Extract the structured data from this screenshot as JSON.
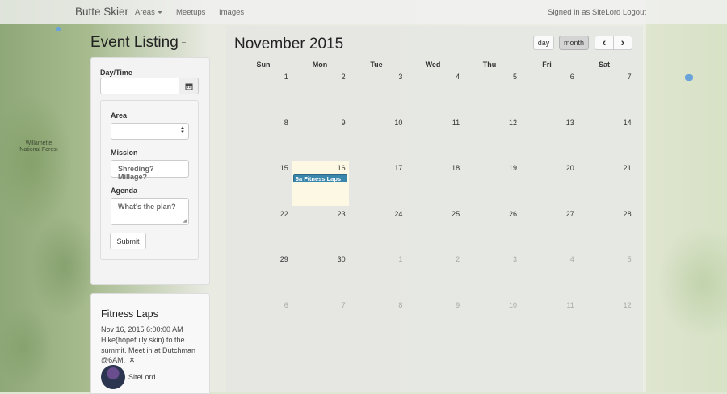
{
  "nav": {
    "brand": "Butte Skier",
    "links": [
      "Areas",
      "Meetups",
      "Images"
    ],
    "right": "Signed in as SiteLord Logout"
  },
  "sidebar": {
    "title": "Event Listing",
    "datetime_label": "Day/Time",
    "datetime_value": "",
    "area_label": "Area",
    "area_value": "",
    "mission_label": "Mission",
    "mission_placeholder": "Shreding? Millage?",
    "agenda_label": "Agenda",
    "agenda_placeholder": "What's the plan?",
    "submit_label": "Submit"
  },
  "event_card": {
    "title": "Fitness Laps",
    "date": "Nov 16, 2015 6:00:00 AM",
    "description": "Hike(hopefully skin) to the summit. Meet in at Dutchman @6AM.",
    "close": "✕",
    "user": "SiteLord"
  },
  "calendar": {
    "title": "November 2015",
    "view_day": "day",
    "view_month": "month",
    "prev": "‹",
    "next": "›",
    "days_of_week": [
      "Sun",
      "Mon",
      "Tue",
      "Wed",
      "Thu",
      "Fri",
      "Sat"
    ],
    "weeks": [
      [
        "1",
        "2",
        "3",
        "4",
        "5",
        "6",
        "7"
      ],
      [
        "8",
        "9",
        "10",
        "11",
        "12",
        "13",
        "14"
      ],
      [
        "15",
        "16",
        "17",
        "18",
        "19",
        "20",
        "21"
      ],
      [
        "22",
        "23",
        "24",
        "25",
        "26",
        "27",
        "28"
      ],
      [
        "29",
        "30",
        "1",
        "2",
        "3",
        "4",
        "5"
      ],
      [
        "6",
        "7",
        "8",
        "9",
        "10",
        "11",
        "12"
      ]
    ],
    "event_label": "6a Fitness Laps"
  },
  "map": {
    "label": "Willamette National Forest"
  }
}
